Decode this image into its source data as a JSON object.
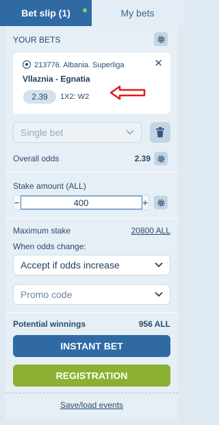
{
  "tabs": [
    {
      "label": "Bet slip (1)"
    },
    {
      "label": "My bets"
    }
  ],
  "your_bets": {
    "label": "YOUR BETS"
  },
  "event": {
    "league": "213776. Albania. Superliga",
    "teams": "Vllaznia - Egnatia",
    "odds": "2.39",
    "market": "1X2: W2"
  },
  "bet_type": {
    "selected": "Single bet"
  },
  "overall_odds": {
    "label": "Overall odds",
    "value": "2.39"
  },
  "stake": {
    "label": "Stake amount (ALL)",
    "value": "400",
    "minus": "−",
    "plus": "+"
  },
  "max_stake": {
    "label": "Maximum stake",
    "value": "20800 ALL"
  },
  "odds_change": {
    "label": "When odds change:",
    "selected": "Accept if odds increase"
  },
  "promo": {
    "placeholder": "Promo code"
  },
  "potential": {
    "label": "Potential winnings",
    "value": "956 ALL"
  },
  "buttons": {
    "instant": "INSTANT BET",
    "registration": "REGISTRATION"
  },
  "save_load": "Save/load events",
  "colors": {
    "primary": "#2f6aa4",
    "accent_green": "#8cb031",
    "annotation_arrow": "#e01b1b"
  }
}
